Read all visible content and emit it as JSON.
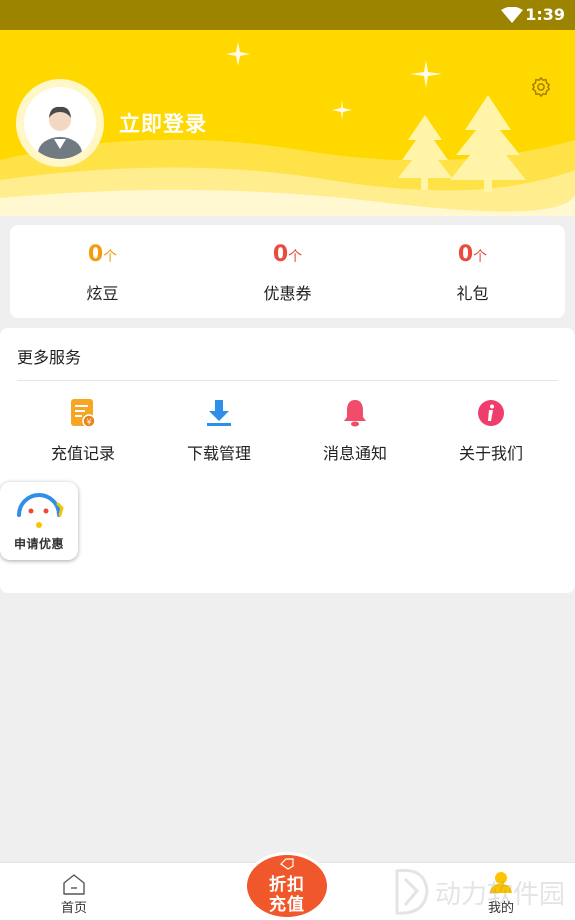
{
  "status_bar": {
    "time": "1:39"
  },
  "header": {
    "login_text": "立即登录"
  },
  "stats": [
    {
      "value": "0",
      "unit": "个",
      "label": "炫豆"
    },
    {
      "value": "0",
      "unit": "个",
      "label": "优惠券"
    },
    {
      "value": "0",
      "unit": "个",
      "label": "礼包"
    }
  ],
  "services": {
    "title": "更多服务",
    "items": [
      {
        "label": "充值记录",
        "icon": "recharge-record-icon"
      },
      {
        "label": "下载管理",
        "icon": "download-icon"
      },
      {
        "label": "消息通知",
        "icon": "bell-icon"
      },
      {
        "label": "关于我们",
        "icon": "info-icon"
      }
    ]
  },
  "promo": {
    "label": "申请优惠"
  },
  "tab_bar": {
    "home": "首页",
    "center_line1": "折扣",
    "center_line2": "充值",
    "mine": "我的"
  },
  "watermark": {
    "text": "动力软件园"
  },
  "colors": {
    "header_yellow": "#ffd800",
    "stat_orange": "#f39c12",
    "stat_red": "#e74c3c",
    "center_button": "#f0572b"
  }
}
